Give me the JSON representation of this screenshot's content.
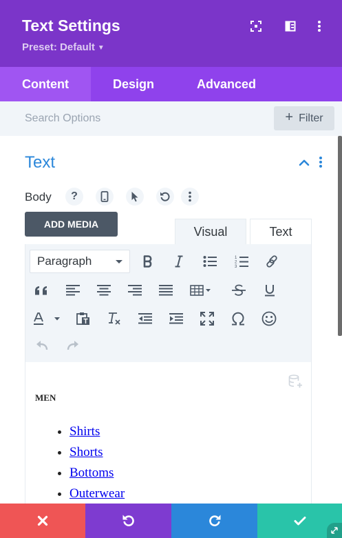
{
  "header": {
    "title": "Text Settings",
    "preset": "Preset: Default"
  },
  "tabs": [
    {
      "label": "Content",
      "active": true
    },
    {
      "label": "Design",
      "active": false
    },
    {
      "label": "Advanced",
      "active": false
    }
  ],
  "search": {
    "placeholder": "Search Options",
    "filter_label": "Filter"
  },
  "section": {
    "title": "Text",
    "field_label": "Body",
    "help": "?"
  },
  "editor": {
    "add_media": "ADD MEDIA",
    "tab_visual": "Visual",
    "tab_text": "Text",
    "format_select": "Paragraph",
    "content_heading": "MEN",
    "content_items": [
      "Shirts",
      "Shorts",
      "Bottoms",
      "Outerwear"
    ]
  },
  "colors": {
    "header_bg": "#7b35c9",
    "tabs_bg": "#8f42ec",
    "accent_blue": "#2b87da",
    "cancel": "#ef5555",
    "undo": "#7e3bd0",
    "redo": "#2b87da",
    "save": "#29c4a9"
  }
}
